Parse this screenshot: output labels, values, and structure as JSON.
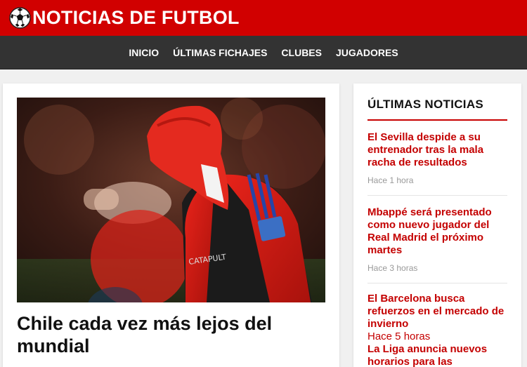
{
  "header": {
    "site_title": "NOTICIAS DE FUTBOL"
  },
  "nav": {
    "items": [
      {
        "label": "INICIO"
      },
      {
        "label": "ÚLTIMAS FICHAJES"
      },
      {
        "label": "CLUBES"
      },
      {
        "label": "JUGADORES"
      }
    ]
  },
  "featured": {
    "title": "Chile cada vez más lejos del mundial",
    "image_icon": "football-player-photo"
  },
  "sidebar": {
    "heading": "ÚLTIMAS NOTICIAS",
    "items": [
      {
        "title": "El Sevilla despide a su entrenador tras la mala racha de resultados",
        "time": "Hace 1 hora"
      },
      {
        "title": "Mbappé será presentado como nuevo jugador del Real Madrid el próximo martes",
        "time": "Hace 3 horas"
      },
      {
        "title": "El Barcelona busca refuerzos en el mercado de invierno",
        "time": "Hace 5 horas"
      },
      {
        "title": "La Liga anuncia nuevos horarios para las",
        "time": ""
      }
    ]
  },
  "colors": {
    "brand_red": "#d10000",
    "nav_dark": "#333333",
    "link_red": "#c40000"
  }
}
